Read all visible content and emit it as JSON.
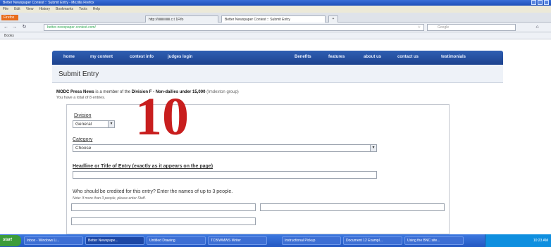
{
  "window": {
    "title": "Better Newspaper Contest :: Submit Entry - Mozilla Firefox"
  },
  "menu": [
    "File",
    "Edit",
    "View",
    "History",
    "Bookmarks",
    "Tools",
    "Help"
  ],
  "tabs": [
    {
      "label": "http://iiiiiiiiiiiiiiii.c.t 1Fifo"
    },
    {
      "label": "Better Newspaper Contest :: Submit Entry"
    }
  ],
  "url": "better-newspaper-contest.com/",
  "search_placeholder": "Google",
  "bookmarks_label": "Books",
  "site_nav": {
    "left": [
      "home",
      "my content",
      "contest info",
      "judges login"
    ],
    "right": [
      "Benefits",
      "features",
      "about us",
      "contact us",
      "testimonials"
    ]
  },
  "page_title": "Submit Entry",
  "membership": {
    "org": "MODC Press News",
    "text": "is a member of the",
    "division": "Division F - Non-dailies under 15,000",
    "group": "(Imdexton group)",
    "count_text": "You have a total of 8 entries."
  },
  "form": {
    "division_label": "Division",
    "division_value": "General",
    "category_label": "Category",
    "category_value": "Choose",
    "headline_label": "Headline or Title of Entry (exactly as it appears on the page)",
    "credit_label": "Who should be credited for this entry? Enter the names of up to 3 people.",
    "credit_hint": "Note: If more than 3 people, please enter Staff."
  },
  "overlay_number": "10",
  "taskbar": {
    "start": "start",
    "tasks": [
      "Inbox - Windows Li...",
      "Better Newspape...",
      "Untitled Drawing",
      "TCBIWMWS Writer",
      "Instructional Pickup",
      "Document 12 Exampl...",
      "Using the BNC site..."
    ],
    "clock": "10:23 AM"
  }
}
